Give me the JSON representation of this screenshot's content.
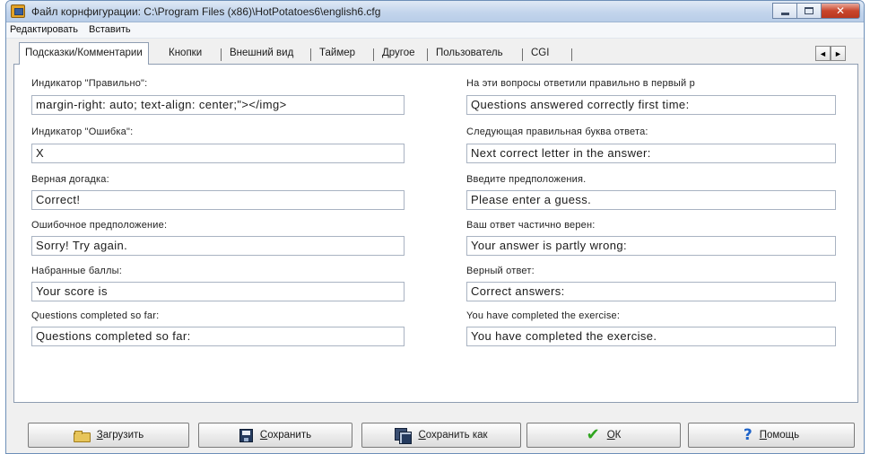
{
  "window": {
    "title": "Файл корнфигурации: C:\\Program Files (x86)\\HotPotatoes6\\english6.cfg",
    "close_glyph": "✕",
    "icon": "app-icon"
  },
  "menu": {
    "items": [
      "Редактировать",
      "Вставить"
    ]
  },
  "tabs": {
    "items": [
      "Подсказки/Комментарии",
      "Кнопки",
      "Внешний вид",
      "Таймер",
      "Другое",
      "Пользователь",
      "CGI"
    ],
    "active": "Подсказки/Комментарии",
    "scroll_left": "◄",
    "scroll_right": "►"
  },
  "fields": {
    "left": [
      {
        "label": "Индикатор \"Правильно\":",
        "value": "margin-right: auto; text-align: center;\"></img>"
      },
      {
        "label": "Индикатор \"Ошибка\":",
        "value": "X"
      },
      {
        "label": "Верная догадка:",
        "value": "Correct!"
      },
      {
        "label": "Ошибочное предположение:",
        "value": "Sorry! Try again."
      },
      {
        "label": "Набранные баллы:",
        "value": "Your score is"
      },
      {
        "label": "Questions completed so far:",
        "value": "Questions completed so far:"
      }
    ],
    "right": [
      {
        "label": "На эти вопросы ответили правильно в первый р",
        "value": "Questions answered correctly first time:"
      },
      {
        "label": "Следующая правильная буква ответа:",
        "value": "Next correct letter in the answer:"
      },
      {
        "label": "Введите предположения.",
        "value": "Please enter a guess."
      },
      {
        "label": "Ваш ответ частично верен:",
        "value": "Your answer is partly wrong:"
      },
      {
        "label": "Верный ответ:",
        "value": "Correct answers:"
      },
      {
        "label": "You have completed the exercise:",
        "value": "You have completed the exercise."
      }
    ]
  },
  "buttons": {
    "load": "Загрузить",
    "save": "Сохранить",
    "save_as": "Сохранить как",
    "ok": "ОК",
    "help": "Помощь",
    "check_glyph": "✔",
    "help_glyph": "?"
  },
  "colors": {
    "titlebar": "#c3d5ec",
    "panel": "#ffffff",
    "window_bg": "#f0f0f0",
    "ok_check": "#2fa51f",
    "help_icon": "#1e63c9"
  }
}
